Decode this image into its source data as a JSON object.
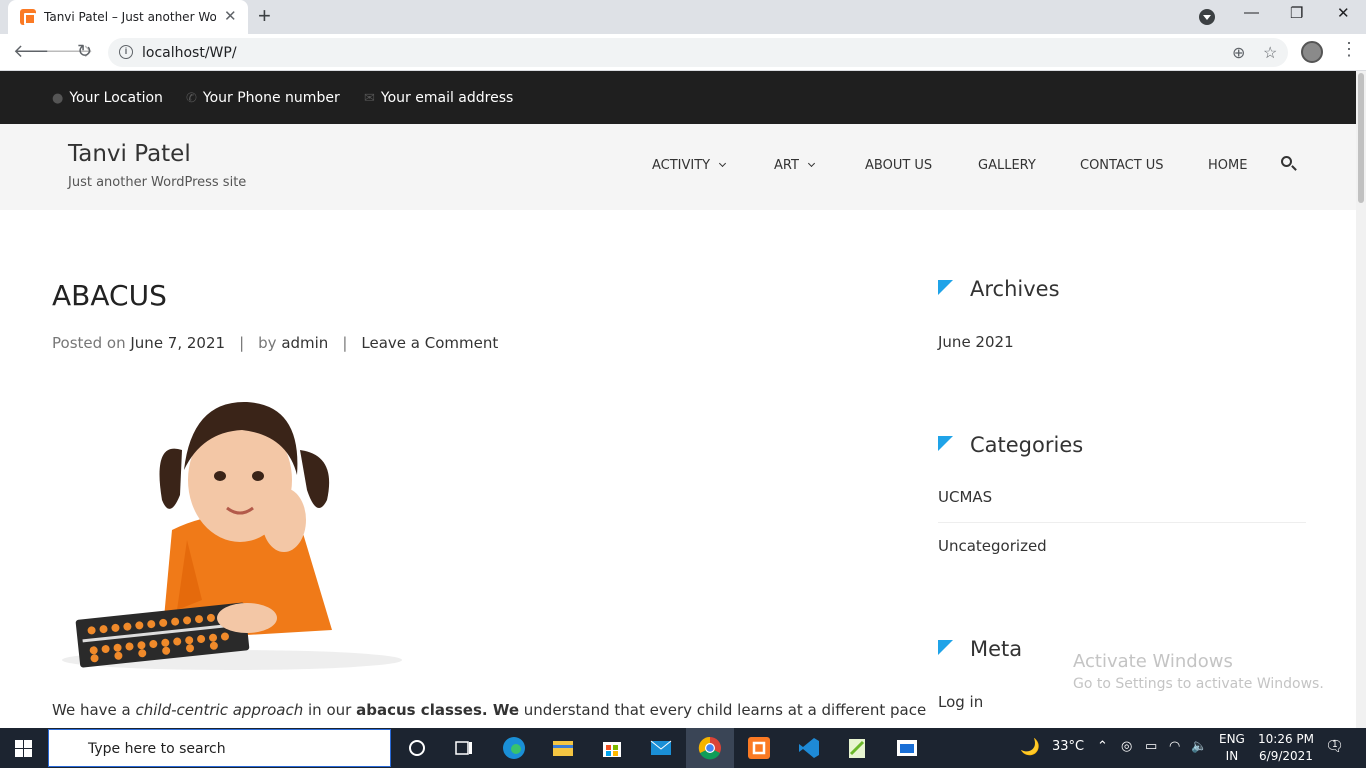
{
  "browser": {
    "tab_title": "Tanvi Patel – Just another WordPress site",
    "tab_close": "✕",
    "new_tab": "+",
    "url": "localhost/WP/",
    "window_min": "—",
    "window_restore": "❐",
    "window_close": "✕"
  },
  "topbar": {
    "location": "Your Location",
    "phone": "Your Phone number",
    "email": "Your email address"
  },
  "site": {
    "title": "Tanvi Patel",
    "tagline": "Just another WordPress site"
  },
  "menu": {
    "activity": "ACTIVITY",
    "art": "ART",
    "about": "ABOUT US",
    "gallery": "GALLERY",
    "contact": "CONTACT US",
    "home": "HOME"
  },
  "post": {
    "title": "ABACUS",
    "posted_on_label": "Posted on",
    "date": "June 7, 2021",
    "by_label": "by",
    "author": "admin",
    "comment_link": "Leave a Comment",
    "excerpt_1": "We have a ",
    "excerpt_2": "child-centric approach",
    "excerpt_3": " in our ",
    "excerpt_4": "abacus classes. We",
    "excerpt_5": " understand that every child learns at a different pace"
  },
  "sidebar": {
    "archives_title": "Archives",
    "archives": [
      "June 2021"
    ],
    "categories_title": "Categories",
    "categories": [
      "UCMAS",
      "Uncategorized"
    ],
    "meta_title": "Meta",
    "meta_links": [
      "Log in"
    ]
  },
  "watermark": {
    "line1": "Activate Windows",
    "line2": "Go to Settings to activate Windows."
  },
  "taskbar": {
    "search_placeholder": "Type here to search",
    "weather": "33°C",
    "lang_1": "ENG",
    "lang_2": "IN",
    "time": "10:26 PM",
    "date": "6/9/2021",
    "notification_count": "1"
  },
  "colors": {
    "accent": "#1fa3e8",
    "topbar": "#1f1f1f",
    "taskbar": "#1c2430"
  }
}
